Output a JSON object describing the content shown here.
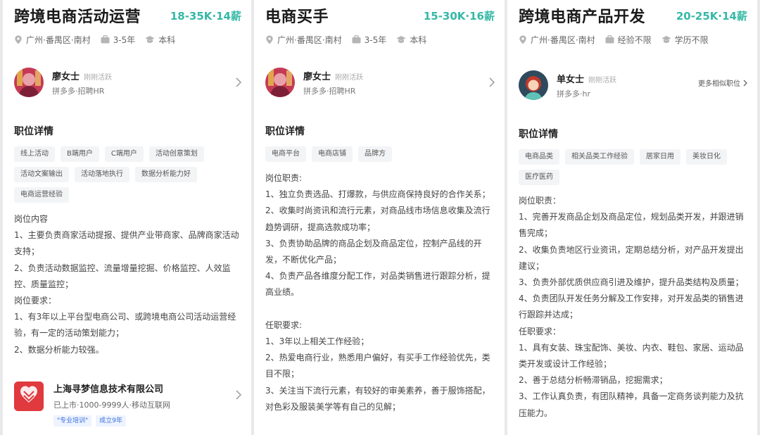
{
  "cards": [
    {
      "title": "跨境电商活动运营",
      "salary": "18-35K·14薪",
      "location": "广州·番禺区·南村",
      "experience": "3-5年",
      "education": "本科",
      "hr": {
        "name": "廖女士",
        "status": "刚刚活跃",
        "role": "拼多多·招聘HR"
      },
      "section_title": "职位详情",
      "tags": [
        "线上活动",
        "B端用户",
        "C端用户",
        "活动创意策划",
        "活动文案输出",
        "活动落地执行",
        "数据分析能力好",
        "电商运营经验"
      ],
      "description": [
        "岗位内容",
        "1、主要负责商家活动提报、提供产业带商家、品牌商家活动支持；",
        "2、负责活动数据监控、流量增量挖掘、价格监控、人效监控、质量监控；",
        "岗位要求：",
        "1、有3年以上平台型电商公司、或跨境电商公司活动运营经验，有一定的活动策划能力；",
        "2、数据分析能力较强。"
      ],
      "company": {
        "name": "上海寻梦信息技术有限公司",
        "info": "已上市·1000-9999人·移动互联网",
        "badges": [
          "\"专业培训\"",
          "成立9年"
        ]
      }
    },
    {
      "title": "电商买手",
      "salary": "15-30K·16薪",
      "location": "广州·番禺区·南村",
      "experience": "3-5年",
      "education": "本科",
      "hr": {
        "name": "廖女士",
        "status": "刚刚活跃",
        "role": "拼多多·招聘HR"
      },
      "section_title": "职位详情",
      "tags": [
        "电商平台",
        "电商店铺",
        "品牌方"
      ],
      "description": [
        "岗位职责:",
        "1、独立负责选品、打爆款，与供应商保持良好的合作关系；",
        "2、收集时尚资讯和流行元素，对商品线市场信息收集及流行趋势调研，提高选款成功率；",
        "3、负责协助品牌的商品企划及商品定位，控制产品线的开发，不断优化产品；",
        "4、负责产品各维度分配工作，对品类销售进行跟踪分析，提高业绩。",
        "",
        "任职要求:",
        "1、3年以上相关工作经验；",
        "2、热爱电商行业，熟悉用户偏好，有买手工作经验优先，类目不限；",
        "3、关注当下流行元素，有较好的审美素养，善于服饰搭配，对色彩及服装美学等有自己的见解；"
      ]
    },
    {
      "title": "跨境电商产品开发",
      "salary": "20-25K·14薪",
      "location": "广州·番禺区·南村",
      "experience": "经验不限",
      "education": "学历不限",
      "hr": {
        "name": "单女士",
        "status": "刚刚活跃",
        "role": "拼多多·hr"
      },
      "more_label": "更多相似职位",
      "section_title": "职位详情",
      "tags": [
        "电商品类",
        "相关品类工作经验",
        "居家日用",
        "美妆日化",
        "医疗医药"
      ],
      "description": [
        "岗位职责：",
        "1、完善开发商品企划及商品定位，规划品类开发，并跟进销售完成；",
        "2、收集负责地区行业资讯，定期总结分析，对产品开发提出建议；",
        "3、负责外部优质供应商引进及维护，提升品类结构及质量；",
        "4、负责团队开发任务分解及工作安排，对开发品类的销售进行跟踪并达成；",
        "任职要求：",
        "1、具有女装、珠宝配饰、美妆、内衣、鞋包、家居、运动品类开发或设计工作经验；",
        "2、善于总结分析畅滞销品，挖掘需求；",
        "3、工作认真负责，有团队精神，具备一定商务谈判能力及抗压能力。"
      ]
    }
  ],
  "icons": {
    "location": "location-pin-icon",
    "experience": "briefcase-icon",
    "education": "graduation-cap-icon",
    "chevron": "chevron-right-icon"
  },
  "colors": {
    "salary": "#35b8a6",
    "badge_text": "#3a6fd8",
    "company_logo": "#e0393e"
  }
}
